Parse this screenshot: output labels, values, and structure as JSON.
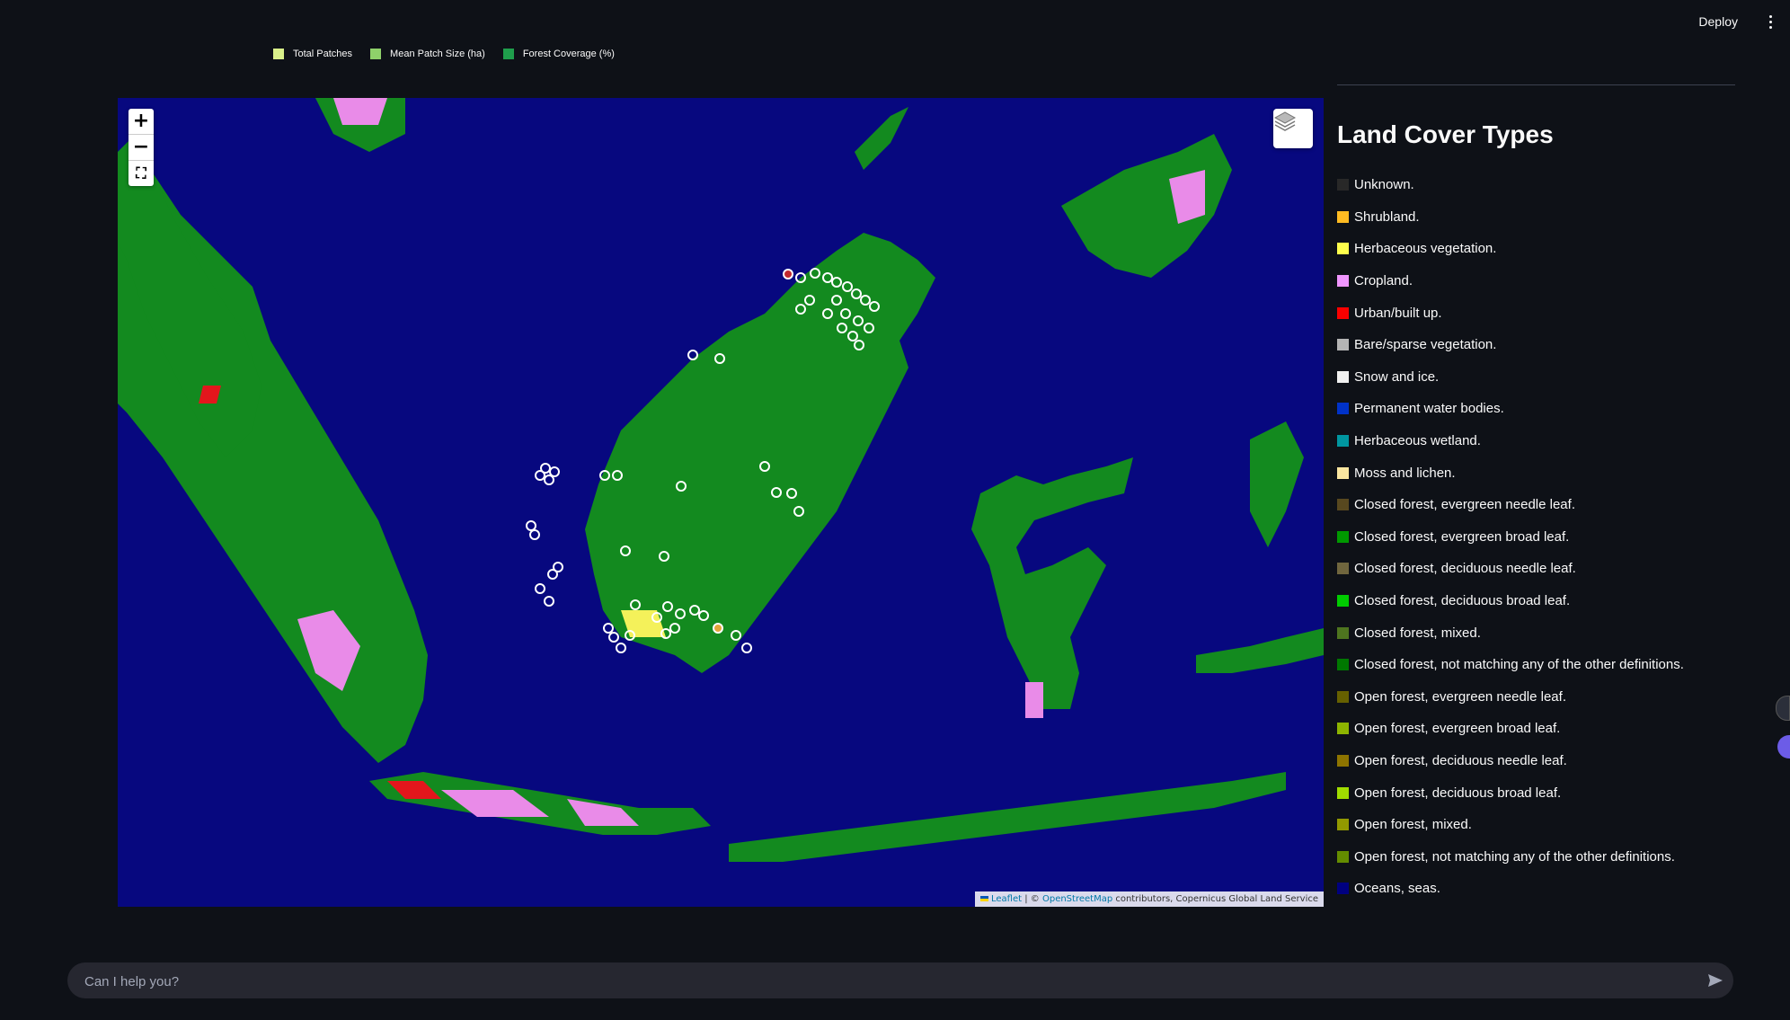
{
  "header": {
    "deploy_label": "Deploy"
  },
  "chart_legend": [
    {
      "label": "Total Patches",
      "color": "#d9f08a"
    },
    {
      "label": "Mean Patch Size (ha)",
      "color": "#8fd16a"
    },
    {
      "label": "Forest Coverage (%)",
      "color": "#1f9e4c"
    }
  ],
  "map": {
    "zoom_in": "+",
    "zoom_out": "−",
    "fullscreen": "⛶",
    "attribution": {
      "leaflet": "Leaflet",
      "sep": " | © ",
      "osm": "OpenStreetMap",
      "rest": " contributors, Copernicus Global Land Service"
    },
    "colors": {
      "ocean": "#07087f",
      "forest": "#138a1f",
      "cropland": "#e98be8",
      "urban": "#e3161c",
      "yellow": "#f4f15a"
    }
  },
  "land_cover": {
    "title": "Land Cover Types",
    "items": [
      {
        "label": "Unknown.",
        "color": "#282828"
      },
      {
        "label": "Shrubland.",
        "color": "#ffbb22"
      },
      {
        "label": "Herbaceous vegetation.",
        "color": "#ffff4c"
      },
      {
        "label": "Cropland.",
        "color": "#f096ff"
      },
      {
        "label": "Urban/built up.",
        "color": "#fa0000"
      },
      {
        "label": "Bare/sparse vegetation.",
        "color": "#b4b4b4"
      },
      {
        "label": "Snow and ice.",
        "color": "#f0f0f0"
      },
      {
        "label": "Permanent water bodies.",
        "color": "#0032c8"
      },
      {
        "label": "Herbaceous wetland.",
        "color": "#0096a0"
      },
      {
        "label": "Moss and lichen.",
        "color": "#fae6a0"
      },
      {
        "label": "Closed forest, evergreen needle leaf.",
        "color": "#58481f"
      },
      {
        "label": "Closed forest, evergreen broad leaf.",
        "color": "#009900"
      },
      {
        "label": "Closed forest, deciduous needle leaf.",
        "color": "#70663e"
      },
      {
        "label": "Closed forest, deciduous broad leaf.",
        "color": "#00cc00"
      },
      {
        "label": "Closed forest, mixed.",
        "color": "#4e751f"
      },
      {
        "label": "Closed forest, not matching any of the other definitions.",
        "color": "#007800"
      },
      {
        "label": "Open forest, evergreen needle leaf.",
        "color": "#666000"
      },
      {
        "label": "Open forest, evergreen broad leaf.",
        "color": "#8db400"
      },
      {
        "label": "Open forest, deciduous needle leaf.",
        "color": "#8d7400"
      },
      {
        "label": "Open forest, deciduous broad leaf.",
        "color": "#a0dc00"
      },
      {
        "label": "Open forest, mixed.",
        "color": "#929900"
      },
      {
        "label": "Open forest, not matching any of the other definitions.",
        "color": "#648c00"
      },
      {
        "label": "Oceans, seas.",
        "color": "#000080"
      }
    ]
  },
  "chat": {
    "placeholder": "Can I help you?"
  }
}
